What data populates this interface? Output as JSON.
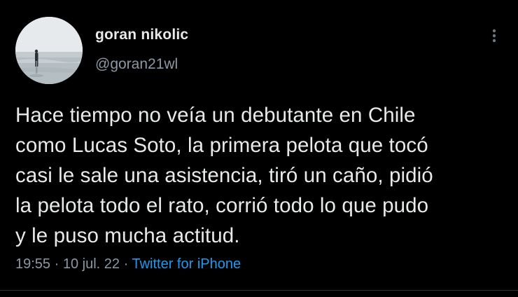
{
  "user": {
    "display_name": "goran nikolic",
    "handle": "@goran21wl"
  },
  "tweet": {
    "text": "Hace tiempo no veía un debutante en Chile\ncomo Lucas Soto, la primera pelota que tocó\ncasi le sale una asistencia, tiró un caño, pidió\nla pelota todo el rato, corrió todo lo que pudo\ny le puso mucha actitud.",
    "time": "19:55",
    "date": "10 jul. 22",
    "separator": "·",
    "source": "Twitter for iPhone"
  },
  "icons": {
    "more": "more-vertical-icon"
  },
  "colors": {
    "background": "#000000",
    "text_primary": "#e7e9ea",
    "text_secondary": "#8b98a5",
    "link": "#1d9bf0",
    "divider": "#2f3336"
  }
}
